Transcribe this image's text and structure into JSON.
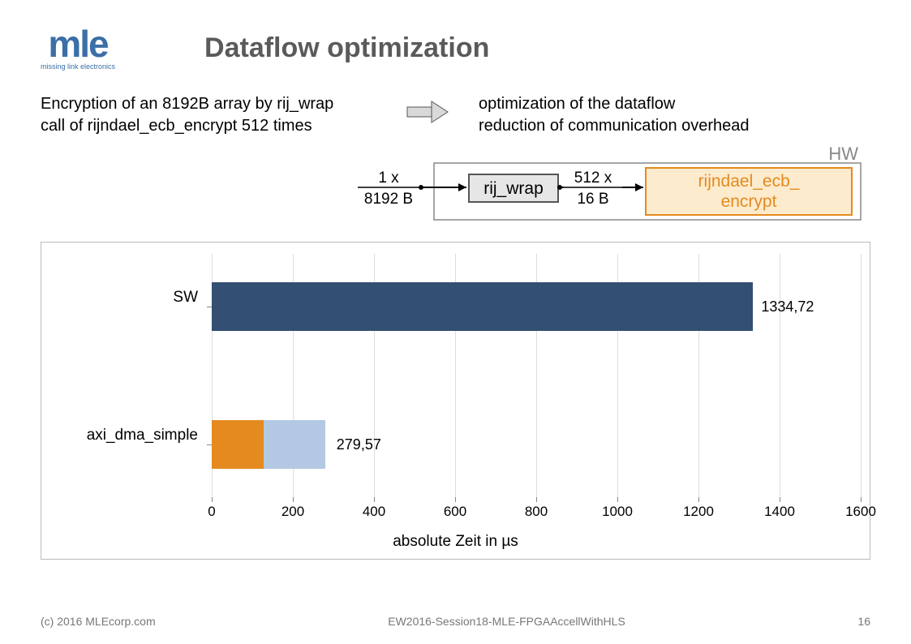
{
  "logo": {
    "main": "mle",
    "sub": "missing link electronics"
  },
  "title": "Dataflow optimization",
  "intro": {
    "left_l1": "Encryption of an 8192B array by rij_wrap",
    "left_l2": "call of rijndael_ecb_encrypt  512 times",
    "right_l1": "optimization of the dataflow",
    "right_l2": "reduction of communication overhead"
  },
  "diagram": {
    "in_top": "1 x",
    "in_bot": "8192 B",
    "box1": "rij_wrap",
    "mid_top": "512 x",
    "mid_bot": "16 B",
    "box2a": "rijndael_ecb_",
    "box2b": "encrypt",
    "hw": "HW"
  },
  "chart_data": {
    "type": "bar",
    "orientation": "horizontal",
    "categories": [
      "SW",
      "axi_dma_simple"
    ],
    "series": [
      {
        "name": "segment1",
        "values": [
          1334.72,
          127
        ],
        "colors": [
          "#334f72",
          "#e58a1f"
        ]
      },
      {
        "name": "segment2",
        "values": [
          0,
          152.57
        ],
        "colors": [
          null,
          "#b3c8e3"
        ]
      }
    ],
    "totals": [
      1334.72,
      279.57
    ],
    "value_labels": [
      "1334,72",
      "279,57"
    ],
    "xlabel": "absolute Zeit in µs",
    "xlim": [
      0,
      1600
    ],
    "xticks": [
      0,
      200,
      400,
      600,
      800,
      1000,
      1200,
      1400,
      1600
    ]
  },
  "footer": {
    "left": "(c) 2016 MLEcorp.com",
    "center": "EW2016-Session18-MLE-FPGAAccellWithHLS",
    "right": "16"
  }
}
